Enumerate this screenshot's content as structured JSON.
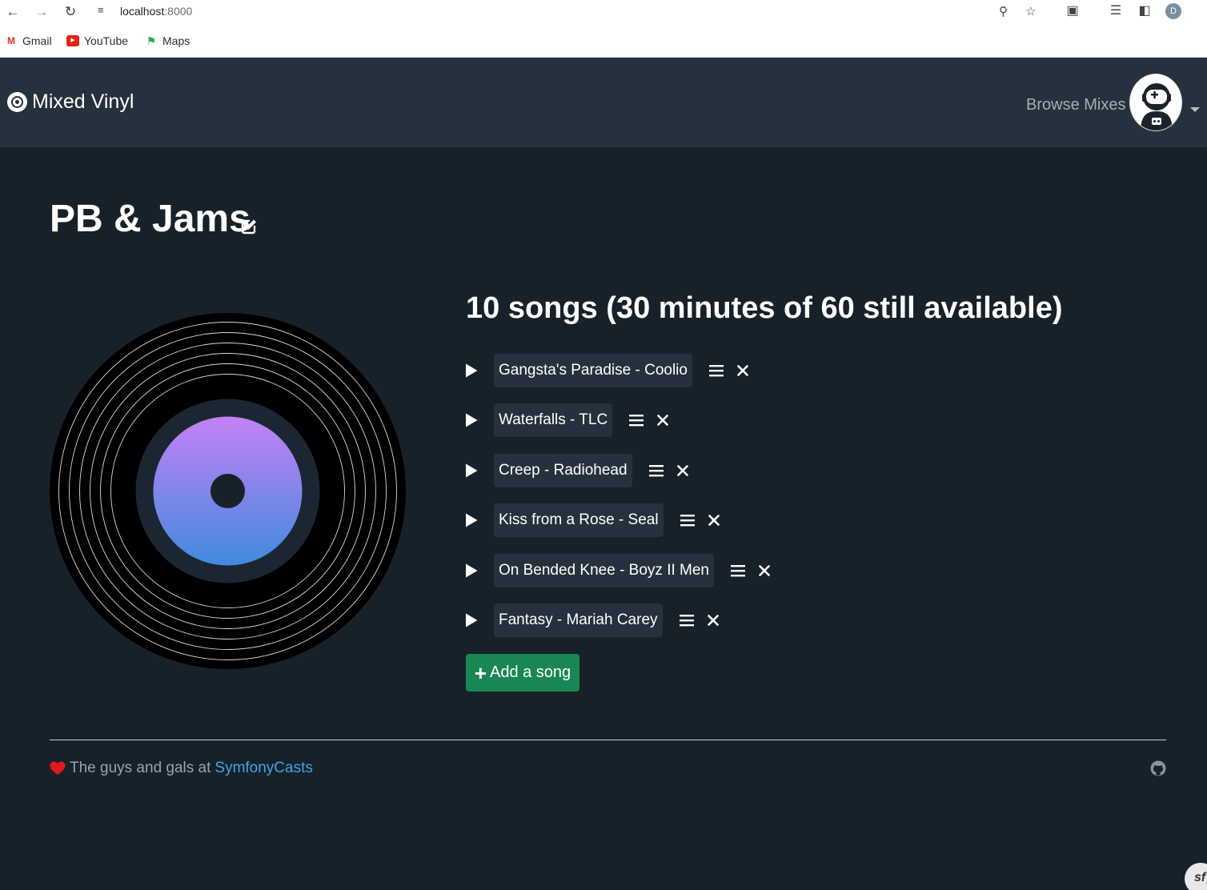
{
  "browser": {
    "url_host": "localhost",
    "url_port": ":8000",
    "profile_initial": "D",
    "bookmarks": [
      {
        "label": "Gmail",
        "icon": "gmail-icon"
      },
      {
        "label": "YouTube",
        "icon": "youtube-icon"
      },
      {
        "label": "Maps",
        "icon": "maps-icon"
      }
    ]
  },
  "navbar": {
    "brand": "Mixed Vinyl",
    "brand_icon": "record-icon",
    "browse_link": "Browse Mixes"
  },
  "mix": {
    "title": "PB & Jams",
    "songs_heading": "10 songs (30 minutes of 60 still available)",
    "songs": [
      {
        "label": "Gangsta's Paradise - Coolio"
      },
      {
        "label": "Waterfalls - TLC"
      },
      {
        "label": "Creep - Radiohead"
      },
      {
        "label": "Kiss from a Rose - Seal"
      },
      {
        "label": "On Bended Knee - Boyz II Men"
      },
      {
        "label": "Fantasy - Mariah Carey"
      }
    ],
    "add_song_label": "Add a song"
  },
  "footer": {
    "text": "The guys and gals at",
    "link": "SymfonyCasts"
  },
  "colors": {
    "page_bg": "#17212a",
    "navbar_bg": "#25323d",
    "add_button": "#198754",
    "link": "#3fa6e8",
    "heart": "#e0191f",
    "label_gradient_top": "#c381f4",
    "label_gradient_bottom": "#418ae0"
  }
}
